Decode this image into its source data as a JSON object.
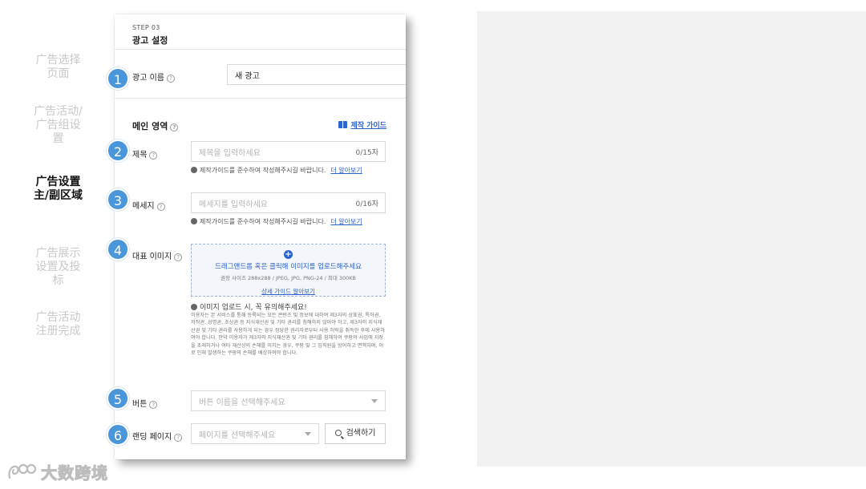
{
  "nav": {
    "steps": [
      {
        "label": "广告选择\n页面",
        "active": false
      },
      {
        "label": "广告活动/\n广告组设\n置",
        "active": false
      },
      {
        "label": "广告设置\n主/副区域",
        "active": true
      },
      {
        "label": "广告展示\n设置及投\n标",
        "active": false
      },
      {
        "label": "广告活动\n注册完成",
        "active": false
      }
    ]
  },
  "card": {
    "step_kicker": "STEP 03",
    "title": "광고 설정",
    "ad_name": {
      "label": "광고 이름",
      "value": "새 광고"
    },
    "main_section": {
      "title": "메인 영역",
      "guide_link": "제작 가이드"
    },
    "title_field": {
      "label": "제목",
      "placeholder": "제목을 입력하세요",
      "counter": "0/15자"
    },
    "message_field": {
      "label": "메세지",
      "placeholder": "메세지를 입력하세요",
      "counter": "0/16자"
    },
    "note": {
      "text": "제작가이드를 준수하여 작성해주시길 바랍니다.",
      "link": "더 알아보기"
    },
    "image": {
      "label": "대표 이미지",
      "upload_main": "드래그앤드롭 혹은 클릭해 이미지를 업로드해주세요",
      "upload_sub": "권장 사이즈 288x288 / JPEG, JPG, PNG-24 / 최대 300KB",
      "upload_link": "상세 가이드 알아보기",
      "warn_title": "이미지 업로드 시, 꼭 유의해주세요!",
      "warn_body": "이용자는 본 서비스를 통해 등록되는 모든 콘텐츠 및 정보에 대하여 제3자의 상표권, 특허권, 저작권, 성명권, 초상권 등 지식재산권 및 기타 권리를 침해하지 않아야 하고, 제3자의 지식재산권 및 기타 권리를 사용하게 되는 경우 정당한 권리자로부터 사용 허락을 취득한 후에 사용하여야 합니다. 만약 이용자가 제3자의 지식재산권 및 기타 권리를 침해하여 쿠팡의 사업에 지장을 초래하거나 여타 재산상의 손해를 미치는 경우, 쿠팡 및 그 임직원을 방어하고 면책하며, 이로 인해 발생하는 쿠팡의 손해를 배상하여야 합니다."
    },
    "button_field": {
      "label": "버튼",
      "placeholder": "버튼 이름을 선택해주세요"
    },
    "landing_field": {
      "label": "랜딩 페이지",
      "placeholder": "페이지를 선택해주세요",
      "search_label": "검색하기"
    }
  },
  "badges": [
    "1",
    "2",
    "3",
    "4",
    "5",
    "6"
  ],
  "help_glyph": "?",
  "plus_glyph": "+",
  "brand": {
    "name": "大数跨境"
  },
  "colors": {
    "accent": "#2e62cc",
    "badge": "#4a96db",
    "panel": "#f2f2f2"
  }
}
